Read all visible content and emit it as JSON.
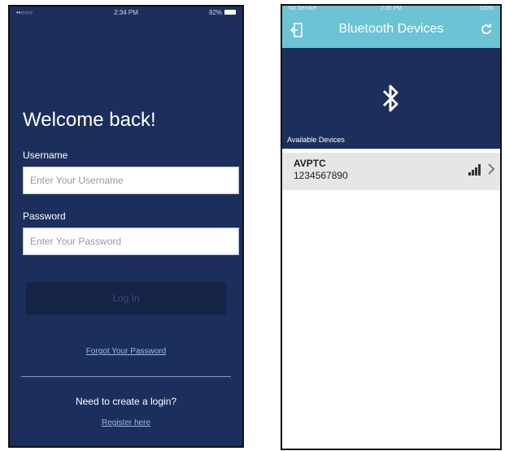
{
  "login": {
    "status": {
      "carrier": "••○○○",
      "time": "2:34 PM",
      "battery": "82%"
    },
    "title": "Welcome back!",
    "username_label": "Username",
    "username_placeholder": "Enter Your Username",
    "password_label": "Password",
    "password_placeholder": "Enter Your Password",
    "login_button": "Log In",
    "forgot_link": "Forgot Your Password",
    "create_prompt": "Need to create a login?",
    "register_link": "Register here"
  },
  "bluetooth": {
    "status": {
      "carrier": "No Service",
      "time": "2:35 PM",
      "battery": "100%"
    },
    "title": "Bluetooth Devices",
    "section_label": "Available Devices",
    "devices": [
      {
        "name": "AVPTC",
        "id": "1234567890"
      }
    ]
  },
  "colors": {
    "navy": "#1c2f5c",
    "teal": "#6cc3d3",
    "button_dark": "#152347",
    "row_gray": "#e6e6e6"
  },
  "icons": [
    "exit-icon",
    "bluetooth-icon",
    "refresh-icon",
    "signal-icon",
    "chevron-right-icon"
  ]
}
